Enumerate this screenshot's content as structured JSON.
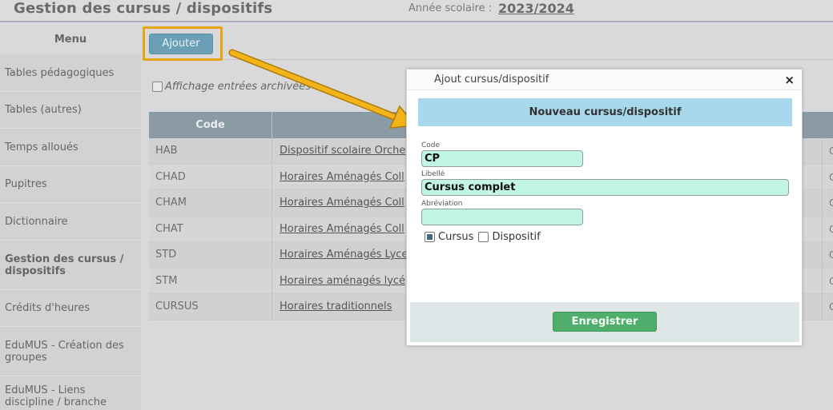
{
  "header": {
    "title": "Gestion des cursus / dispositifs",
    "year_label": "Année scolaire :",
    "year_value": "2023/2024"
  },
  "sidebar": {
    "menu_label": "Menu",
    "items": [
      {
        "label": "Tables pédagogiques"
      },
      {
        "label": "Tables (autres)"
      },
      {
        "label": "Temps alloués"
      },
      {
        "label": "Pupitres"
      },
      {
        "label": "Dictionnaire"
      },
      {
        "label": "Gestion des cursus / dispositifs",
        "active": true
      },
      {
        "label": "Crédits d'heures"
      },
      {
        "label": "EduMUS - Création des groupes"
      },
      {
        "label": "EduMUS - Liens discipline / branche"
      }
    ]
  },
  "toolbar": {
    "add_label": "Ajouter",
    "archive_label": "Affichage entrées archivées"
  },
  "table": {
    "col_code": "Code",
    "rows": [
      {
        "code": "HAB",
        "libelle": "Dispositif scolaire Orche",
        "right": "C"
      },
      {
        "code": "CHAD",
        "libelle": "Horaires Aménagés Coll",
        "right": "C"
      },
      {
        "code": "CHAM",
        "libelle": "Horaires Aménagés Coll",
        "right": "C"
      },
      {
        "code": "CHAT",
        "libelle": "Horaires Aménagés Coll",
        "right": "C"
      },
      {
        "code": "STD",
        "libelle": "Horaires Aménagés Lyce",
        "right": "C"
      },
      {
        "code": "STM",
        "libelle": "Horaires aménagés lycé",
        "right": "C"
      },
      {
        "code": "CURSUS",
        "libelle": "Horaires traditionnels",
        "right": "C"
      }
    ]
  },
  "modal": {
    "title": "Ajout cursus/dispositif",
    "close": "×",
    "header": "Nouveau cursus/dispositif",
    "code_label": "Code",
    "code_value": "CP",
    "libelle_label": "Libellé",
    "libelle_value": "Cursus complet",
    "abrev_label": "Abréviation",
    "abrev_value": "",
    "opt_cursus": "Cursus",
    "opt_dispositif": "Dispositif",
    "save_label": "Enregistrer"
  },
  "colors": {
    "highlight": "#e8a510",
    "header_blue": "#a7d8eb",
    "save_green": "#4fae6c",
    "field_bg": "#c3f5e5"
  }
}
